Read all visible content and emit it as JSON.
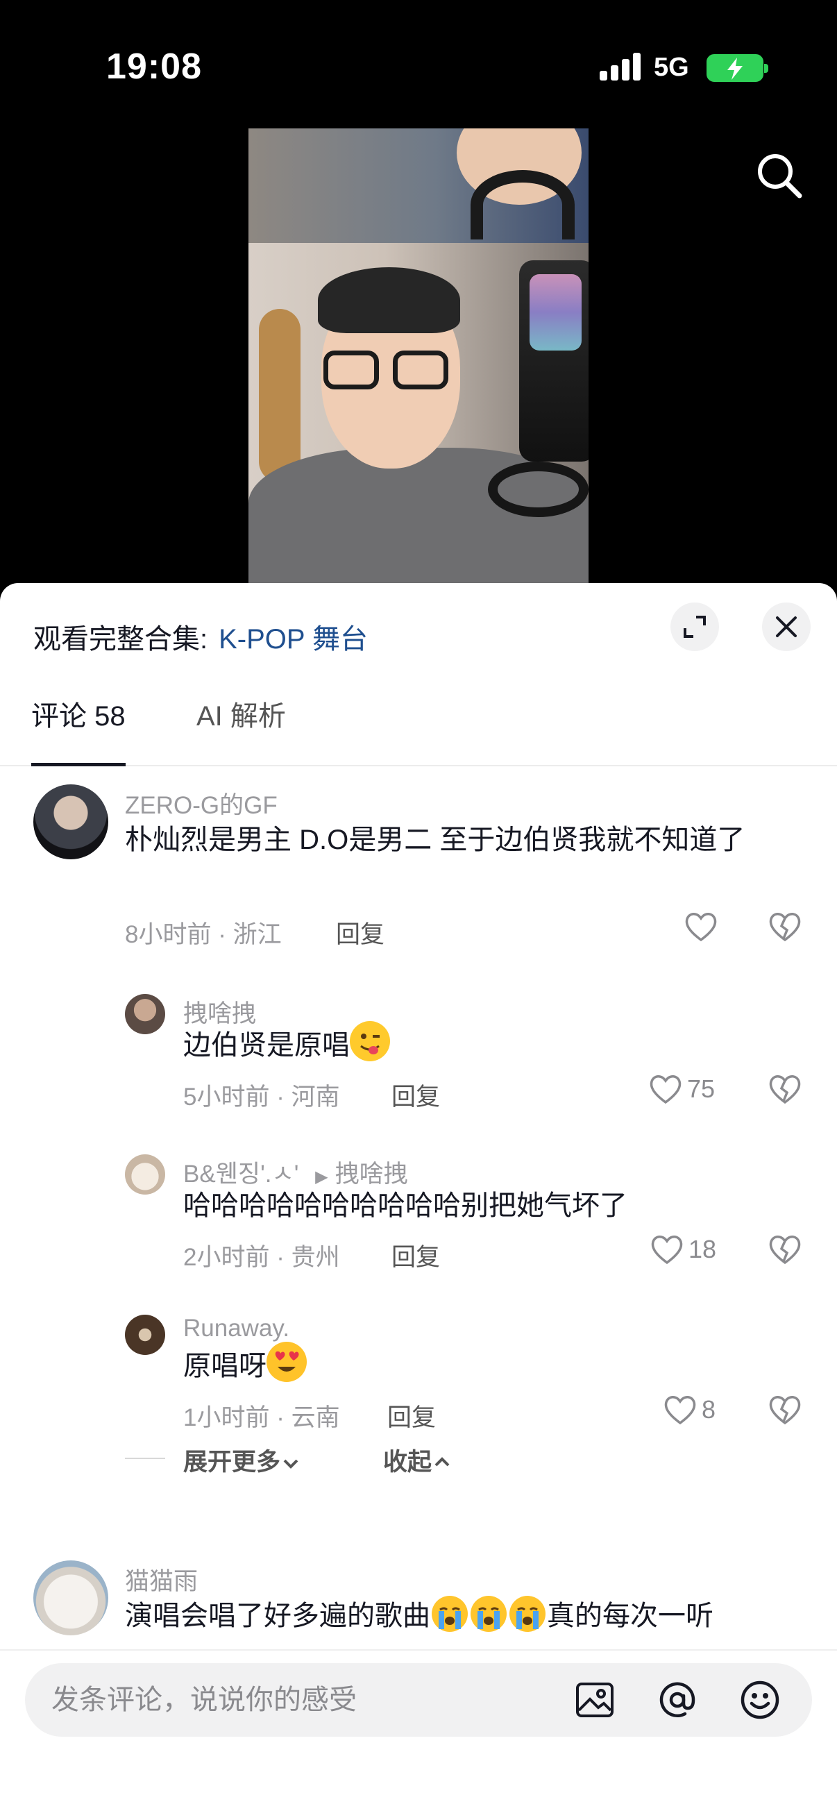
{
  "status_bar": {
    "time": "19:08",
    "network": "5G"
  },
  "sheet": {
    "collection_prefix": "观看完整合集:",
    "collection_link": "K-POP 舞台",
    "tabs": [
      {
        "label": "评论 58",
        "active": true
      },
      {
        "label": "AI 解析",
        "active": false
      }
    ]
  },
  "comments": [
    {
      "author": "ZERO-G的GF",
      "text": "朴灿烈是男主   D.O是男二   至于边伯贤我就不知道了",
      "meta": "8小时前 · 浙江",
      "reply": "回复",
      "likes": ""
    },
    {
      "author": "拽啥拽",
      "text": "边伯贤是原唱",
      "meta": "5小时前 · 河南",
      "reply": "回复",
      "likes": "75"
    },
    {
      "author": "B&웬징'.ㅅ'",
      "reply_to": "拽啥拽",
      "text": "哈哈哈哈哈哈哈哈哈哈别把她气坏了",
      "meta": "2小时前 · 贵州",
      "reply": "回复",
      "likes": "18"
    },
    {
      "author": "Runaway.",
      "text": "原唱呀",
      "meta": "1小时前 · 云南",
      "reply": "回复",
      "likes": "8"
    },
    {
      "author": "猫猫雨",
      "text_before": "演唱会唱了好多遍的歌曲",
      "text_after": "真的每次一听"
    }
  ],
  "thread_controls": {
    "expand_more": "展开更多",
    "collapse": "收起"
  },
  "input": {
    "placeholder": "发条评论，说说你的感受"
  },
  "icons": [
    "search-icon",
    "expand-icon",
    "close-icon",
    "heart-icon",
    "broken-heart-icon",
    "image-icon",
    "at-icon",
    "emoji-icon"
  ],
  "colors": {
    "link": "#1f4f8f",
    "battery": "#2fd158",
    "text": "#161823",
    "secondary": "#9a9a9e"
  }
}
